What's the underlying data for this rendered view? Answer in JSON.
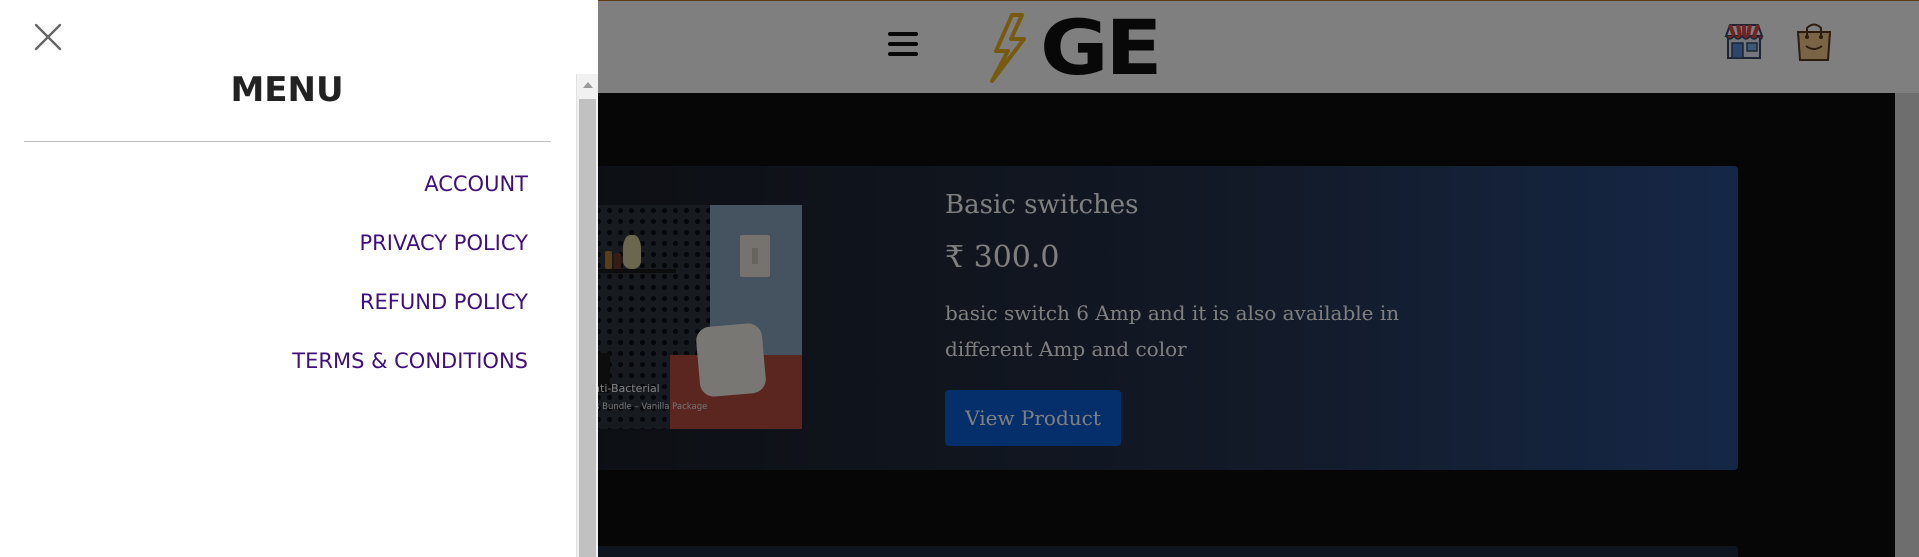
{
  "header": {
    "logo_text": "GE",
    "menu_icon": "hamburger-menu-icon",
    "store_icon": "store-icon",
    "bag_icon": "shopping-bag-icon"
  },
  "menu": {
    "close_icon": "close-icon",
    "title": "MENU",
    "items": [
      {
        "label": "ACCOUNT"
      },
      {
        "label": "PRIVACY POLICY"
      },
      {
        "label": "REFUND POLICY"
      },
      {
        "label": "TERMS & CONDITIONS"
      }
    ]
  },
  "product": {
    "title": "Basic switches",
    "price": "₹ 300.0",
    "description": "basic switch 6 Amp and it is also available in different Amp and color",
    "button_label": "View Product",
    "image_caption_main": "via: Anti-Bacterial",
    "image_caption_sub": "e Homes Bundle – Vanilla Package"
  },
  "colors": {
    "accent_button": "#0b5ed7",
    "menu_link": "#3f0f7c",
    "logo_bolt": "#f0b41e",
    "overlay": "rgba(0,0,0,0.5)"
  }
}
